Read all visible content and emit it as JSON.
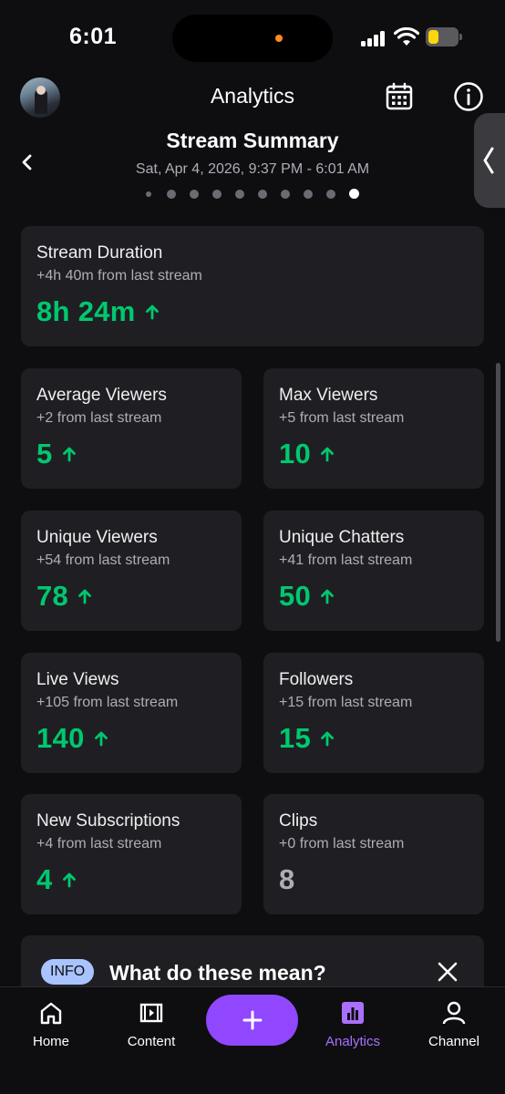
{
  "status_bar": {
    "time": "6:01"
  },
  "header": {
    "title": "Analytics"
  },
  "summary": {
    "title": "Stream Summary",
    "date_range": "Sat, Apr 4, 2026, 9:37 PM - 6:01 AM",
    "page_count": 10,
    "active_page": 10
  },
  "duration_card": {
    "label": "Stream Duration",
    "change": "+4h 40m from last stream",
    "value": "8h 24m",
    "trend": "up"
  },
  "stats": [
    {
      "label": "Average Viewers",
      "change": "+2 from last stream",
      "value": "5",
      "trend": "up"
    },
    {
      "label": "Max Viewers",
      "change": "+5 from last stream",
      "value": "10",
      "trend": "up"
    },
    {
      "label": "Unique Viewers",
      "change": "+54 from last stream",
      "value": "78",
      "trend": "up"
    },
    {
      "label": "Unique Chatters",
      "change": "+41 from last stream",
      "value": "50",
      "trend": "up"
    },
    {
      "label": "Live Views",
      "change": "+105 from last stream",
      "value": "140",
      "trend": "up"
    },
    {
      "label": "Followers",
      "change": "+15 from last stream",
      "value": "15",
      "trend": "up"
    },
    {
      "label": "New Subscriptions",
      "change": "+4 from last stream",
      "value": "4",
      "trend": "up"
    },
    {
      "label": "Clips",
      "change": "+0 from last stream",
      "value": "8",
      "trend": "none"
    }
  ],
  "info_banner": {
    "badge": "INFO",
    "heading": "What do these mean?"
  },
  "bottom_nav": {
    "items": [
      {
        "label": "Home",
        "icon": "home-icon"
      },
      {
        "label": "Content",
        "icon": "content-icon"
      },
      {
        "label": "Analytics",
        "icon": "analytics-icon",
        "active": true
      },
      {
        "label": "Channel",
        "icon": "person-icon"
      }
    ],
    "create_icon": "plus-icon"
  },
  "colors": {
    "positive": "#00c86f",
    "neutral": "#adadb8",
    "accent": "#9147ff",
    "active_nav": "#a970ff",
    "card": "#1f1f23",
    "background": "#0e0e10"
  }
}
